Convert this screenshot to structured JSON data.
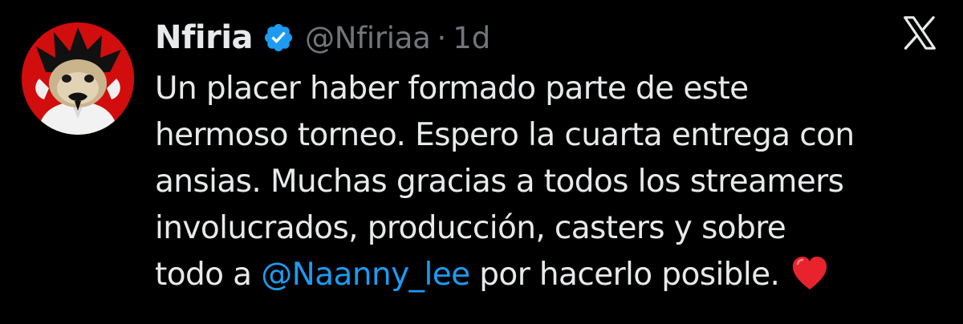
{
  "tweet": {
    "author": {
      "display_name": "Nfiria",
      "handle": "@Nfiriaa",
      "verified": true,
      "verified_badge_color": "#1d9bf0",
      "avatar_background": "#d10d0d"
    },
    "separator": "·",
    "timestamp": "1d",
    "text_lines": {
      "line1": "Un placer haber formado parte de este",
      "line2": "hermoso torneo. Espero la cuarta entrega con",
      "line3": "ansias. Muchas gracias a todos los streamers",
      "line4": "involucrados, producción, casters y sobre",
      "line5_before": "todo a ",
      "line5_mention": "@Naanny_lee",
      "line5_after": " por hacerlo posible."
    },
    "emoji": "red-heart",
    "mention_color": "#1d9bf0",
    "platform_icon": "x-logo-icon"
  },
  "colors": {
    "background": "#000000",
    "text_primary": "#e7e9ea",
    "text_secondary": "#71767b"
  }
}
